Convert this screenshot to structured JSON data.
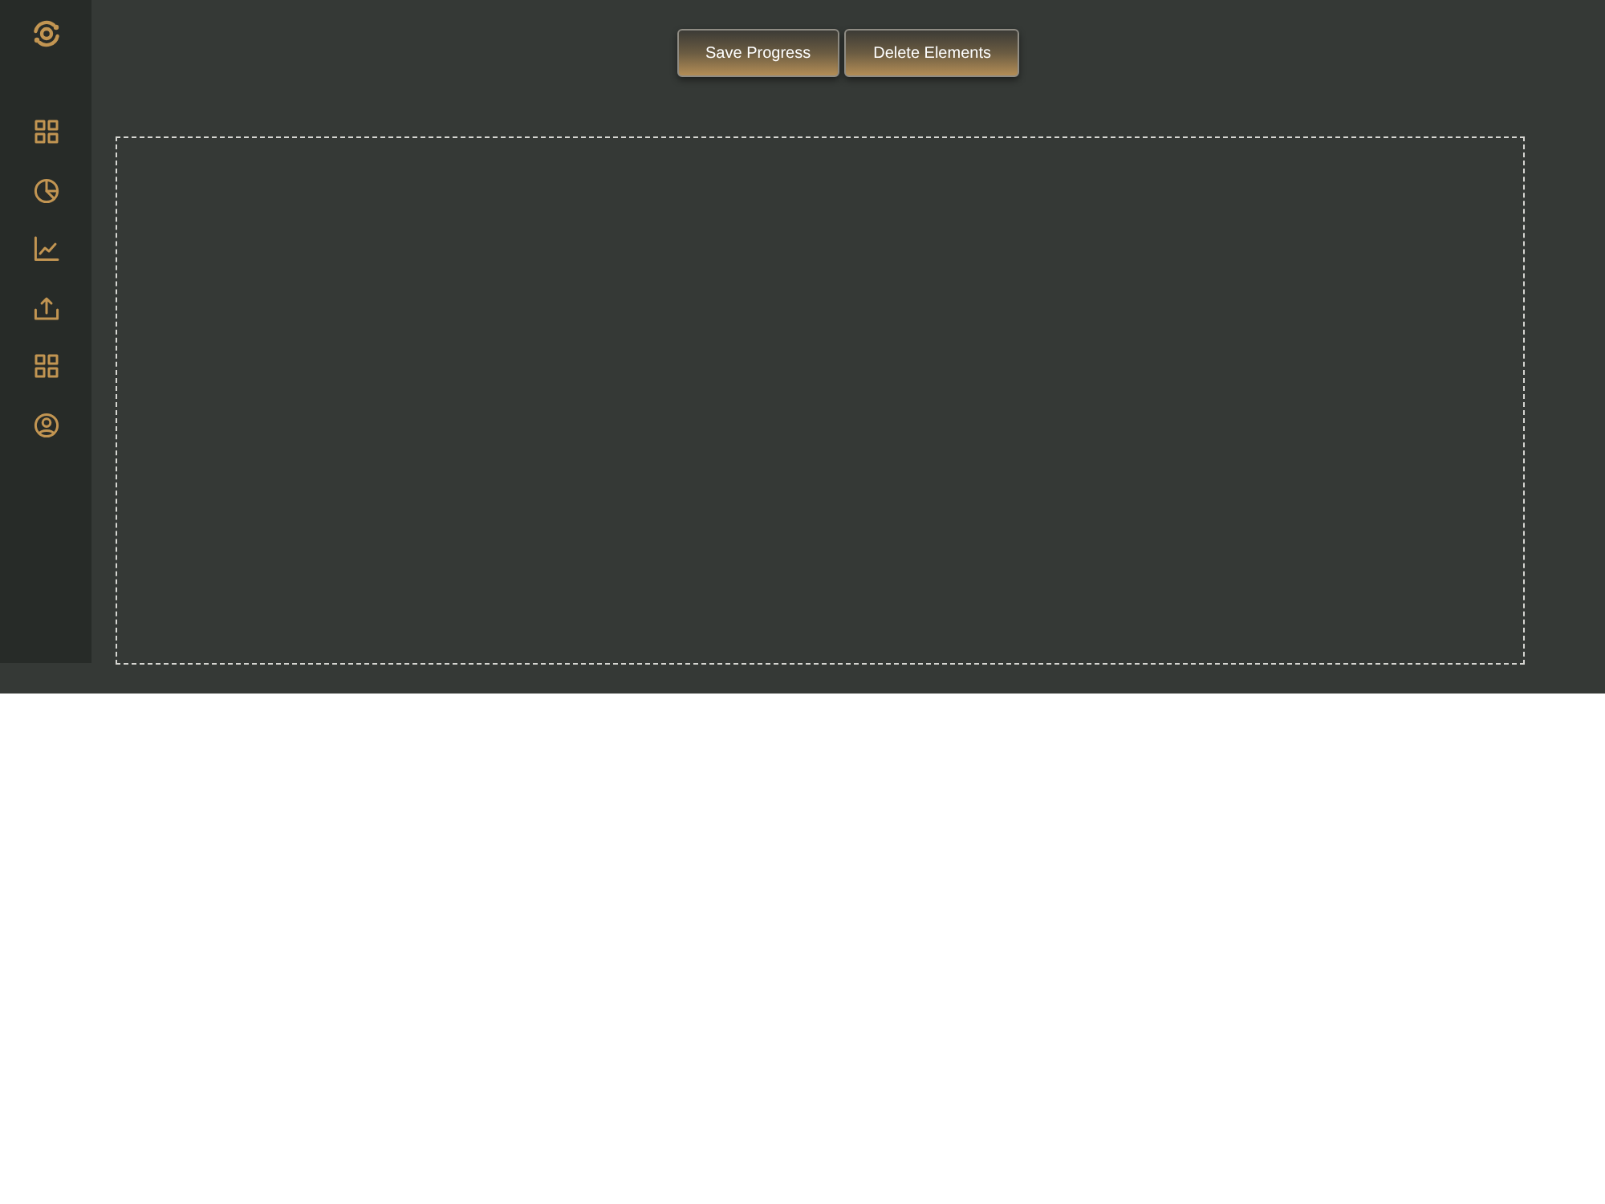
{
  "toolbar": {
    "buttons": [
      "Save Progress",
      "Delete Elements"
    ]
  }
}
